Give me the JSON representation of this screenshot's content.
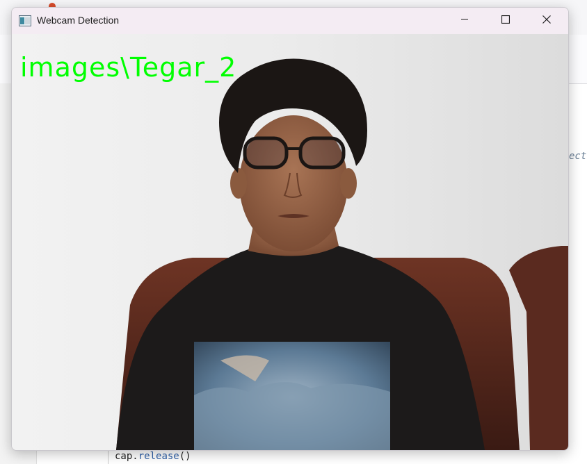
{
  "window": {
    "title": "Webcam Detection",
    "controls": {
      "minimize": "minimize-icon",
      "maximize": "maximize-icon",
      "close": "close-icon"
    }
  },
  "video": {
    "detection_label": "images\\Tegar_2",
    "label_color": "#00ff00"
  },
  "background_editor": {
    "code_object": "cap",
    "code_method": "release",
    "code_suffix": "()",
    "clipped_text": "ect"
  },
  "colors": {
    "titlebar": "#f4ecf3",
    "wall": "#e6e6e6",
    "shirt": "#1c1a1a",
    "chair": "#5a2a1f"
  }
}
